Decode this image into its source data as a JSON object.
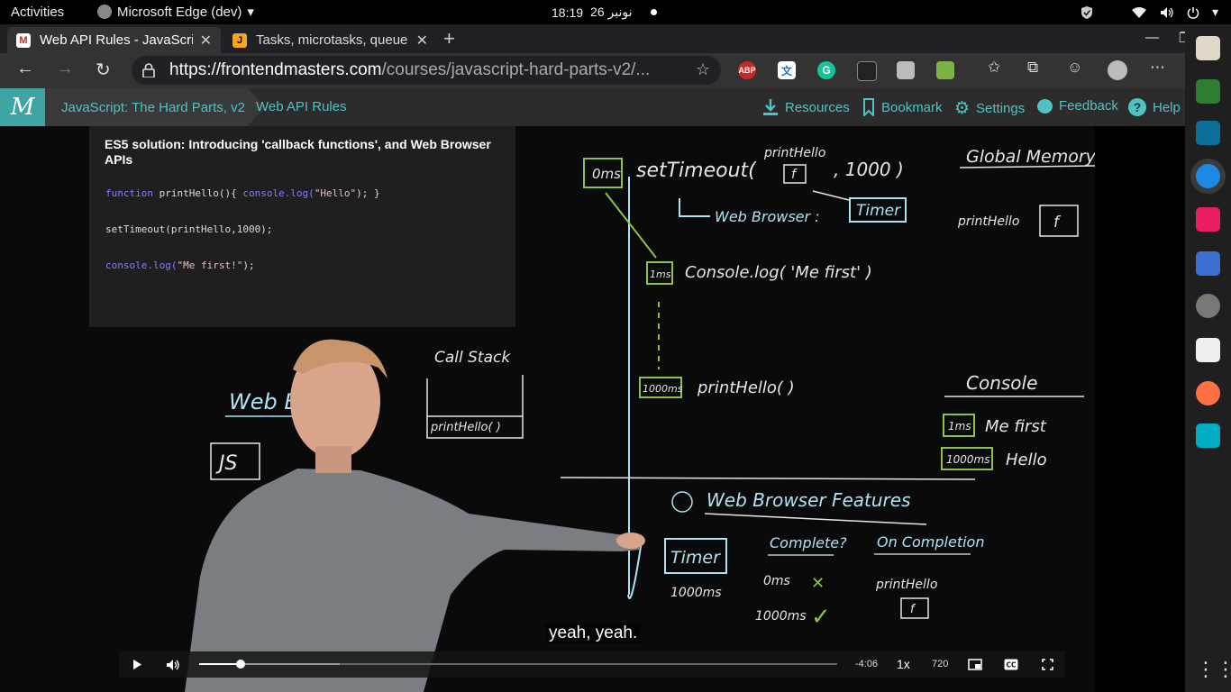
{
  "top_bar": {
    "activities": "Activities",
    "app_name": "Microsoft Edge (dev)",
    "clock_time": "18:19",
    "clock_date": "26 نونبر"
  },
  "browser": {
    "tabs": [
      {
        "title": "Web API Rules - JavaScrip",
        "favicon_letter": "M",
        "active": true
      },
      {
        "title": "Tasks, microtasks, queue",
        "favicon_letter": "J",
        "active": false
      }
    ],
    "url_host": "https://frontendmasters.com",
    "url_path": "/courses/javascript-hard-parts-v2/...",
    "extensions": [
      "ABP",
      "translate",
      "grammarly",
      "ext-1",
      "ext-2",
      "ext-3"
    ]
  },
  "site": {
    "logo": "M",
    "breadcrumb_course": "JavaScript: The Hard Parts, v2",
    "breadcrumb_lesson": "Web API Rules",
    "header_links": {
      "resources": "Resources",
      "bookmark": "Bookmark",
      "settings": "Settings",
      "feedback": "Feedback",
      "help": "Help"
    }
  },
  "slide": {
    "title": "ES5 solution: Introducing 'callback functions', and Web Browser APIs",
    "code": {
      "line1_kw": "function",
      "line1_rest": " printHello(){ ",
      "line1_call": "console.log(",
      "line1_str": "\"Hello\"",
      "line1_end": "); }",
      "line2": "setTimeout(printHello,1000);",
      "line3_call": "console.log(",
      "line3_str": "\"Me first!\"",
      "line3_end": ");"
    }
  },
  "whiteboard": {
    "oms": "0ms",
    "settimeout": "setTimeout(",
    "printhello_arg": "printHello",
    "f": "f",
    "thousand": ", 1000 )",
    "web_browser": "Web Browser :",
    "timer": "Timer",
    "ms1": "1ms",
    "console_log": "Console.log( 'Me first' )",
    "ms1000": "1000ms",
    "printhello_call": "printHello( )",
    "global_memory": "Global Memory",
    "printhello_mem": "printHello",
    "console_title": "Console",
    "console_ms1": "1ms",
    "console_me_first": "Me first",
    "console_ms1000": "1000ms",
    "console_hello": "Hello",
    "call_stack": "Call Stack",
    "call_stack_item": "printHello( )",
    "web_left": "Web B",
    "js": "JS",
    "features": "Web Browser Features",
    "timer2": "Timer",
    "timer_ms": "1000ms",
    "complete": "Complete?",
    "on_completion": "On Completion",
    "zero_ms": "0ms",
    "cross": "✕",
    "thousand_ms": "1000ms",
    "check": "✓",
    "printhello_cb": "printHello",
    "f2": "f"
  },
  "player": {
    "caption": "yeah, yeah.",
    "time_remaining": "-4:06",
    "speed": "1x",
    "quality": "720",
    "progress_played": 0.065,
    "progress_buffered": 0.22
  }
}
